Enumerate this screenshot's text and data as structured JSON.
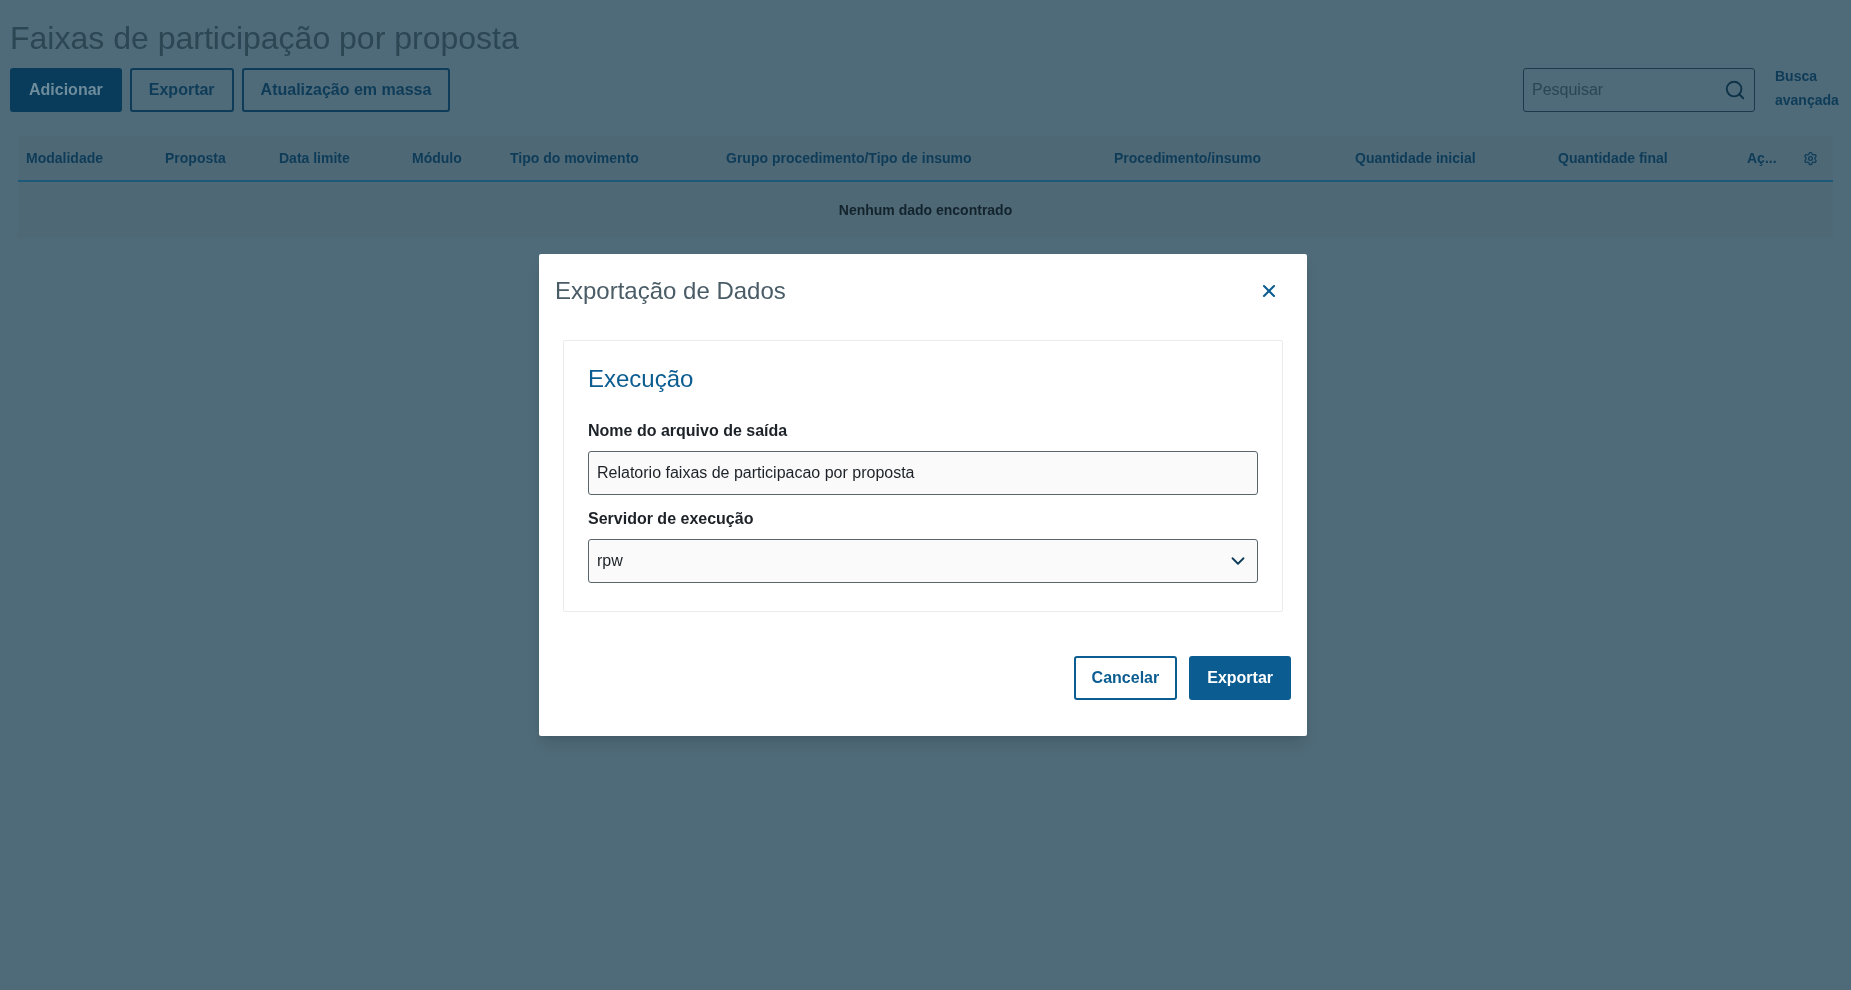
{
  "page": {
    "title": "Faixas de participação por proposta"
  },
  "toolbar": {
    "buttons": [
      {
        "label": "Adicionar",
        "kind": "primary"
      },
      {
        "label": "Exportar",
        "kind": "secondary"
      },
      {
        "label": "Atualização em massa",
        "kind": "secondary"
      }
    ],
    "search": {
      "placeholder": "Pesquisar"
    },
    "advanced_search": "Busca avançada"
  },
  "table": {
    "columns": [
      "Modalidade",
      "Proposta",
      "Data limite",
      "Módulo",
      "Tipo do movimento",
      "Grupo procedimento/Tipo de insumo",
      "Procedimento/insumo",
      "Quantidade inicial",
      "Quantidade final",
      "Aç..."
    ],
    "empty_message": "Nenhum dado encontrado"
  },
  "dialog": {
    "title": "Exportação de Dados",
    "section_title": "Execução",
    "fields": [
      {
        "label": "Nome do arquivo de saída",
        "kind": "text",
        "value": "Relatorio faixas de participacao por proposta"
      },
      {
        "label": "Servidor de execução",
        "kind": "select",
        "value": "rpw"
      }
    ],
    "buttons": [
      {
        "label": "Cancelar",
        "kind": "secondary"
      },
      {
        "label": "Exportar",
        "kind": "primary"
      }
    ]
  }
}
